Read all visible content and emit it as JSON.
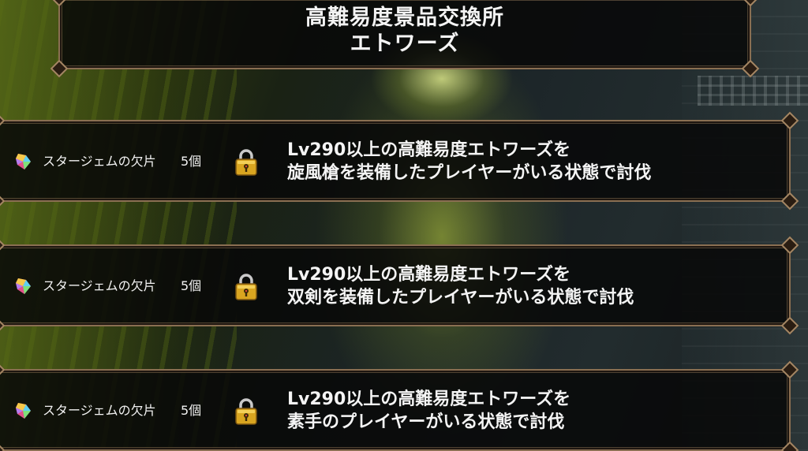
{
  "header": {
    "title_line1": "高難易度景品交換所",
    "title_line2": "エトワーズ"
  },
  "rewards": [
    {
      "item_icon": "star-gem-fragment-icon",
      "item_name": "スタージェムの欠片",
      "quantity": "5個",
      "status_icon": "padlock-icon",
      "condition_line1": "Lv290以上の高難易度エトワーズを",
      "condition_line2": "旋風槍を装備したプレイヤーがいる状態で討伐"
    },
    {
      "item_icon": "star-gem-fragment-icon",
      "item_name": "スタージェムの欠片",
      "quantity": "5個",
      "status_icon": "padlock-icon",
      "condition_line1": "Lv290以上の高難易度エトワーズを",
      "condition_line2": "双剣を装備したプレイヤーがいる状態で討伐"
    },
    {
      "item_icon": "star-gem-fragment-icon",
      "item_name": "スタージェムの欠片",
      "quantity": "5個",
      "status_icon": "padlock-icon",
      "condition_line1": "Lv290以上の高難易度エトワーズを",
      "condition_line2": "素手のプレイヤーがいる状態で討伐"
    }
  ],
  "colors": {
    "panel_border": "#8a6f52",
    "text": "#f4f4f4",
    "lock_gold": "#d9a520"
  }
}
